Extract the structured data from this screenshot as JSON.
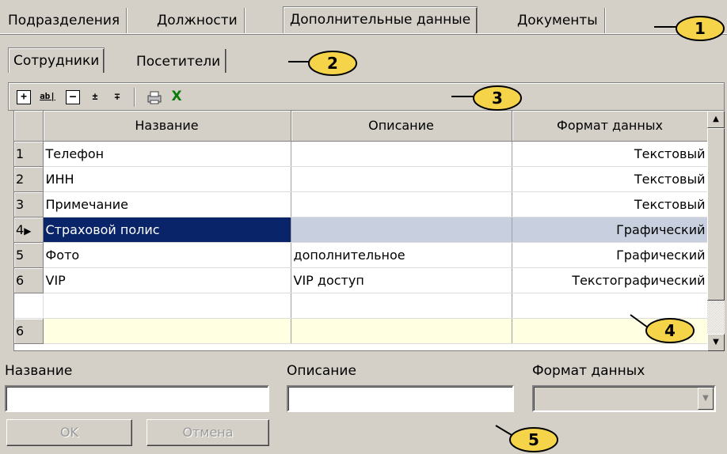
{
  "top_tabs": [
    "Подразделения",
    "Должности",
    "Дополнительные данные",
    "Документы"
  ],
  "top_tabs_active": "Дополнительные данные",
  "sub_tabs": [
    "Сотрудники",
    "Посетители"
  ],
  "sub_tabs_active": "Сотрудники",
  "toolbar": {
    "buttons": [
      {
        "name": "add-row-icon",
        "glyph": "+"
      },
      {
        "name": "edit-row-icon",
        "glyph": "ab|"
      },
      {
        "name": "delete-row-icon",
        "glyph": "–"
      },
      {
        "name": "move-up-icon",
        "glyph": "▴"
      },
      {
        "name": "move-down-icon",
        "glyph": "▾"
      },
      {
        "name": "print-icon",
        "glyph": "🖨"
      },
      {
        "name": "excel-export-icon",
        "glyph": "X"
      }
    ]
  },
  "grid": {
    "columns": [
      "Название",
      "Описание",
      "Формат данных"
    ],
    "rows": [
      {
        "idx": "1",
        "name": "Телефон",
        "desc": "",
        "fmt": "Текстовый"
      },
      {
        "idx": "2",
        "name": "ИНН",
        "desc": "",
        "fmt": "Текстовый"
      },
      {
        "idx": "3",
        "name": "Примечание",
        "desc": "",
        "fmt": "Текстовый"
      },
      {
        "idx": "4",
        "name": "Страховой полис",
        "desc": "",
        "fmt": "Графический"
      },
      {
        "idx": "5",
        "name": "Фото",
        "desc": "дополнительное",
        "fmt": "Графический"
      },
      {
        "idx": "6",
        "name": "VIP",
        "desc": "VIP доступ",
        "fmt": "Текстографический"
      }
    ],
    "selected_row": "4",
    "new_row_idx": "6"
  },
  "form": {
    "name_label": "Название",
    "desc_label": "Описание",
    "format_label": "Формат данных",
    "name_value": "",
    "desc_value": "",
    "format_value": "",
    "ok_label": "OK",
    "cancel_label": "Отмена"
  },
  "callouts": [
    "1",
    "2",
    "3",
    "4",
    "5"
  ]
}
